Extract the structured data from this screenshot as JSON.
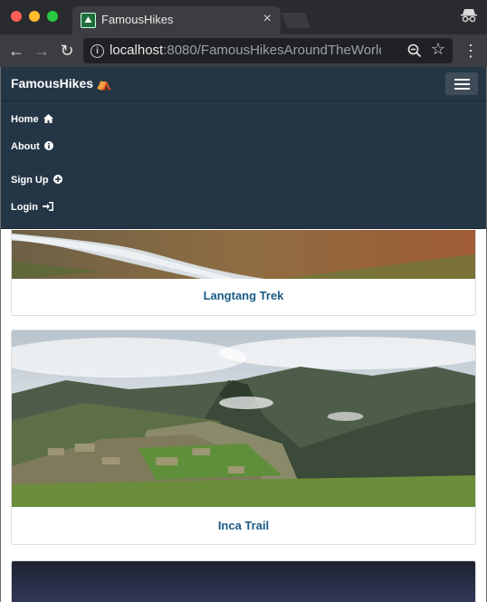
{
  "browser": {
    "tab_title": "FamousHikes",
    "tab_close": "×",
    "url_host": "localhost",
    "url_rest": ":8080/FamousHikesAroundTheWorldM...",
    "back_icon": "←",
    "forward_icon": "→",
    "reload_icon": "↻"
  },
  "site": {
    "brand": "FamousHikes",
    "nav": {
      "home": "Home",
      "about": "About",
      "signup": "Sign Up",
      "login": "Login"
    },
    "cards": [
      {
        "title": "Langtang Trek"
      },
      {
        "title": "Inca Trail"
      }
    ]
  }
}
